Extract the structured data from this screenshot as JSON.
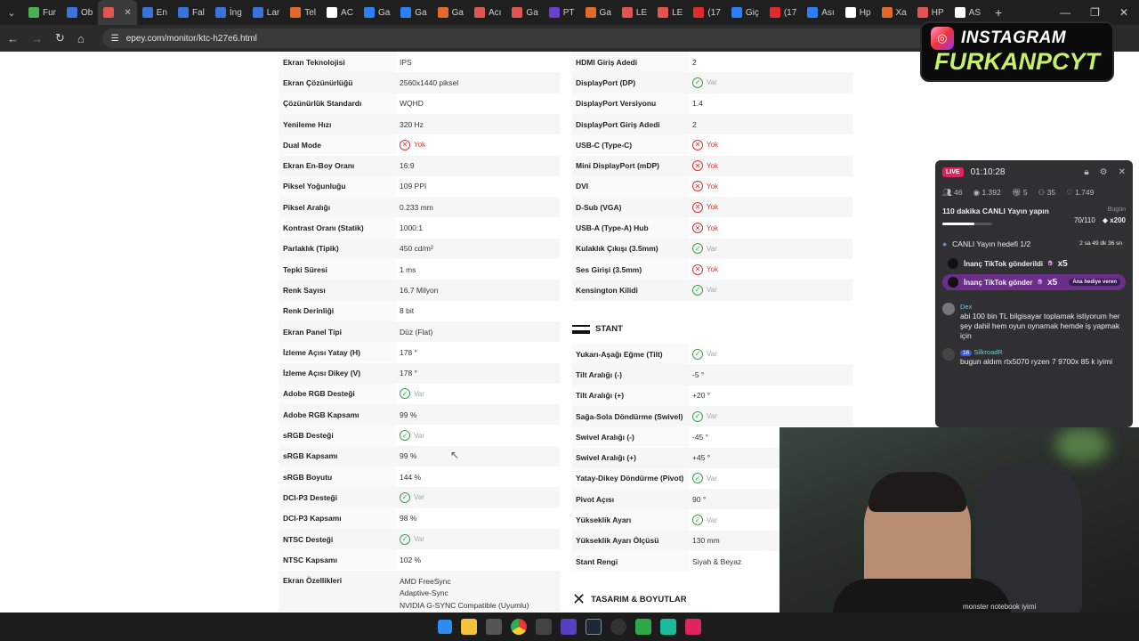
{
  "browser": {
    "tabs": [
      {
        "label": "Fur",
        "color": "#4caf50"
      },
      {
        "label": "Ob",
        "color": "#3b73d9"
      },
      {
        "label": "",
        "color": "#e0554f",
        "active": true
      },
      {
        "label": "En",
        "color": "#3b73d9"
      },
      {
        "label": "Fal",
        "color": "#3b73d9"
      },
      {
        "label": "İng",
        "color": "#3b73d9"
      },
      {
        "label": "Lar",
        "color": "#3b73d9"
      },
      {
        "label": "Tel",
        "color": "#e06a2c"
      },
      {
        "label": "AC",
        "color": "#ffffff"
      },
      {
        "label": "Ga",
        "color": "#2d7ff9"
      },
      {
        "label": "Ga",
        "color": "#2d7ff9"
      },
      {
        "label": "Ga",
        "color": "#e06a2c"
      },
      {
        "label": "Acı",
        "color": "#e0554f"
      },
      {
        "label": "Ga",
        "color": "#e0554f"
      },
      {
        "label": "PT",
        "color": "#6b3fd0"
      },
      {
        "label": "Ga",
        "color": "#e06a2c"
      },
      {
        "label": "LE",
        "color": "#e0554f"
      },
      {
        "label": "LE",
        "color": "#e0554f"
      },
      {
        "label": "(17",
        "color": "#e02b2b"
      },
      {
        "label": "Giç",
        "color": "#2d7ff9"
      },
      {
        "label": "(17",
        "color": "#e02b2b"
      },
      {
        "label": "Ası",
        "color": "#2d7ff9"
      },
      {
        "label": "Hp",
        "color": "#ffffff"
      },
      {
        "label": "Xa",
        "color": "#e06a2c"
      },
      {
        "label": "HP",
        "color": "#e0554f"
      },
      {
        "label": "AS",
        "color": "#ffffff"
      }
    ],
    "url": "epey.com/monitor/ktc-h27e6.html"
  },
  "specs_left": [
    {
      "k": "Ekran Teknolojisi",
      "v": "IPS"
    },
    {
      "k": "Ekran Çözünürlüğü",
      "v": "2560x1440 piksel"
    },
    {
      "k": "Çözünürlük Standardı",
      "v": "WQHD"
    },
    {
      "k": "Yenileme Hızı",
      "v": "320 Hz"
    },
    {
      "k": "Dual Mode",
      "v": "Yok",
      "mark": "no"
    },
    {
      "k": "Ekran En-Boy Oranı",
      "v": "16:9"
    },
    {
      "k": "Piksel Yoğunluğu",
      "v": "109 PPI"
    },
    {
      "k": "Piksel Aralığı",
      "v": "0.233 mm"
    },
    {
      "k": "Kontrast Oranı (Statik)",
      "v": "1000:1"
    },
    {
      "k": "Parlaklık (Tipik)",
      "v": "450 cd/m²"
    },
    {
      "k": "Tepki Süresi",
      "v": "1 ms"
    },
    {
      "k": "Renk Sayısı",
      "v": "16.7 Milyon"
    },
    {
      "k": "Renk Derinliği",
      "v": "8 bit"
    },
    {
      "k": "Ekran Panel Tipi",
      "v": "Düz (Flat)"
    },
    {
      "k": "İzleme Açısı Yatay (H)",
      "v": "178 °"
    },
    {
      "k": "İzleme Açısı Dikey (V)",
      "v": "178 °"
    },
    {
      "k": "Adobe RGB Desteği",
      "v": "Var",
      "mark": "yes"
    },
    {
      "k": "Adobe RGB Kapsamı",
      "v": "99 %"
    },
    {
      "k": "sRGB Desteği",
      "v": "Var",
      "mark": "yes"
    },
    {
      "k": "sRGB Kapsamı",
      "v": "99 %"
    },
    {
      "k": "sRGB Boyutu",
      "v": "144 %"
    },
    {
      "k": "DCI-P3 Desteği",
      "v": "Var",
      "mark": "yes"
    },
    {
      "k": "DCI-P3 Kapsamı",
      "v": "98 %"
    },
    {
      "k": "NTSC Desteği",
      "v": "Var",
      "mark": "yes"
    },
    {
      "k": "NTSC Kapsamı",
      "v": "102 %"
    },
    {
      "k": "Ekran Özellikleri",
      "v": "AMD FreeSync\nAdaptive-Sync\nNVIDIA G-SYNC Compatible (Uyumlu)"
    }
  ],
  "specs_right_ports": [
    {
      "k": "HDMI Giriş Adedi",
      "v": "2"
    },
    {
      "k": "DisplayPort (DP)",
      "v": "Var",
      "mark": "yes"
    },
    {
      "k": "DisplayPort Versiyonu",
      "v": "1.4"
    },
    {
      "k": "DisplayPort Giriş Adedi",
      "v": "2"
    },
    {
      "k": "USB-C (Type-C)",
      "v": "Yok",
      "mark": "no"
    },
    {
      "k": "Mini DisplayPort (mDP)",
      "v": "Yok",
      "mark": "no"
    },
    {
      "k": "DVI",
      "v": "Yok",
      "mark": "no"
    },
    {
      "k": "D-Sub (VGA)",
      "v": "Yok",
      "mark": "no"
    },
    {
      "k": "USB-A (Type-A) Hub",
      "v": "Yok",
      "mark": "no"
    },
    {
      "k": "Kulaklık Çıkışı (3.5mm)",
      "v": "Var",
      "mark": "yes"
    },
    {
      "k": "Ses Girişi (3.5mm)",
      "v": "Yok",
      "mark": "no"
    },
    {
      "k": "Kensington Kilidi",
      "v": "Var",
      "mark": "yes"
    }
  ],
  "section_stand": "STANT",
  "specs_right_stand": [
    {
      "k": "Yukarı-Aşağı Eğme (Tilt)",
      "v": "Var",
      "mark": "yes"
    },
    {
      "k": "Tilt Aralığı (-)",
      "v": "-5 °"
    },
    {
      "k": "Tilt Aralığı (+)",
      "v": "+20 °"
    },
    {
      "k": "Sağa-Sola Döndürme (Swivel)",
      "v": "Var",
      "mark": "yes"
    },
    {
      "k": "Swivel Aralığı (-)",
      "v": "-45 °"
    },
    {
      "k": "Swivel Aralığı (+)",
      "v": "+45 °"
    },
    {
      "k": "Yatay-Dikey Döndürme (Pivot)",
      "v": "Var",
      "mark": "yes"
    },
    {
      "k": "Pivot Açısı",
      "v": "90 °"
    },
    {
      "k": "Yükseklik Ayarı",
      "v": "Var",
      "mark": "yes"
    },
    {
      "k": "Yükseklik Ayarı Ölçüsü",
      "v": "130 mm"
    },
    {
      "k": "Stant Rengi",
      "v": "Siyah & Beyaz"
    }
  ],
  "section_design": "TASARIM & BOYUTLAR",
  "overlay": {
    "instagram_l1": "INSTAGRAM",
    "instagram_l2": "FURKANPCYT",
    "live_badge": "LIVE",
    "live_time": "01:10:28",
    "stats": [
      "46",
      "1.392",
      "5",
      "35",
      "1.749"
    ],
    "goal_title": "110 dakika CANLI Yayın yapın",
    "goal_sub": "Bugün",
    "goal_progress": "70/110",
    "goal_reward": "x200",
    "goal_fraction": 0.64,
    "goal2_title": "CANLI Yayın hedefi 1/2",
    "goal2_time": "2 sa 49 dk 36 sn",
    "gift1": "İnanç TikTok gönderildi",
    "gift1_count": "x5",
    "gift2": "İnanç TikTok gönder",
    "gift2_count": "x5",
    "gift2_tag": "Ana hediye veren",
    "msg1_user": "Dex",
    "msg1_text": "abi 100 bin TL bilgisayar toplamak istiyorum her şey dahil hem oyun oynamak hemde iş yapmak için",
    "msg2_user": "SilkroadR",
    "msg2_level": "16",
    "msg2_text": "bugun aldım rtx5070 ryzen 7 9700x 85 k iyimi",
    "cam_caption": "monster notebook iyimi"
  }
}
